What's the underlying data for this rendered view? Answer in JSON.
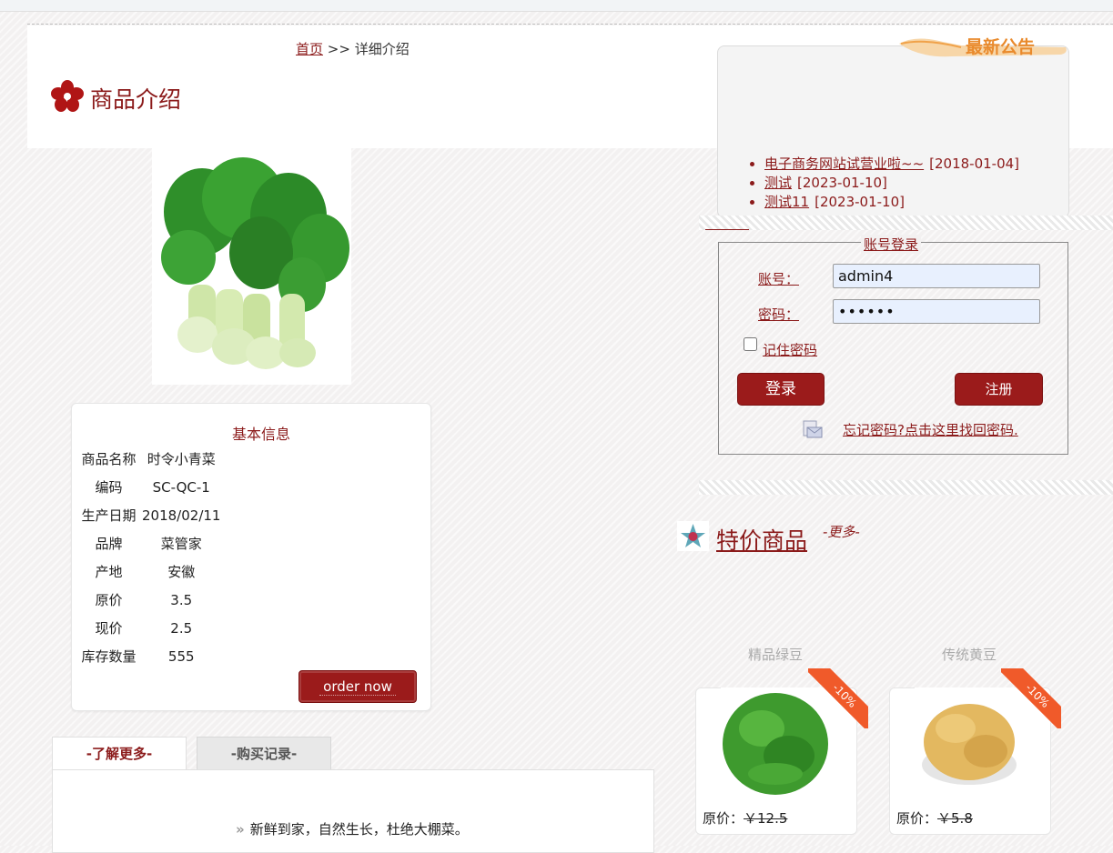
{
  "breadcrumb": {
    "home": "首页",
    "separator": ">>",
    "current": "详细介绍"
  },
  "page_title": "商品介绍",
  "product": {
    "info_title": "基本信息",
    "fields": [
      {
        "label": "商品名称",
        "value": "时令小青菜"
      },
      {
        "label": "编码",
        "value": "SC-QC-1"
      },
      {
        "label": "生产日期",
        "value": "2018/02/11"
      },
      {
        "label": "品牌",
        "value": "菜管家"
      },
      {
        "label": "产地",
        "value": "安徽"
      },
      {
        "label": "原价",
        "value": "3.5"
      },
      {
        "label": "现价",
        "value": "2.5"
      },
      {
        "label": "库存数量",
        "value": "555"
      }
    ],
    "order_button": "order now"
  },
  "tabs": [
    {
      "label": "-了解更多-",
      "active": true
    },
    {
      "label": "-购买记录-",
      "active": false
    }
  ],
  "description": "新鲜到家，自然生长，杜绝大棚菜。",
  "notice": {
    "banner": "最新公告",
    "items": [
      {
        "text": "电子商务网站试营业啦~~",
        "date": "[2018-01-04]"
      },
      {
        "text": "测试",
        "date": "[2023-01-10]"
      },
      {
        "text": "测试11",
        "date": "[2023-01-10]"
      }
    ]
  },
  "login": {
    "legend": "账号登录",
    "account_label": "账号：",
    "account_value": "admin4",
    "password_label": "密码：",
    "password_value": "••••••",
    "remember_label": "记住密码",
    "login_button": "登录",
    "register_button": "注册",
    "forgot_link": "忘记密码?点击这里找回密码."
  },
  "specials": {
    "title": "特价商品",
    "more": "-更多-",
    "items": [
      {
        "name": "精品绿豆",
        "badge": "-10%",
        "price_label": "原价：",
        "price": "￥12.5"
      },
      {
        "name": "传统黄豆",
        "badge": "-10%",
        "price_label": "原价：",
        "price": "￥5.8"
      }
    ]
  },
  "colors": {
    "accent": "#8b1a1a",
    "button": "#9b1b1b",
    "ribbon": "#f05a2a",
    "input_bg": "#e8f0fe"
  }
}
